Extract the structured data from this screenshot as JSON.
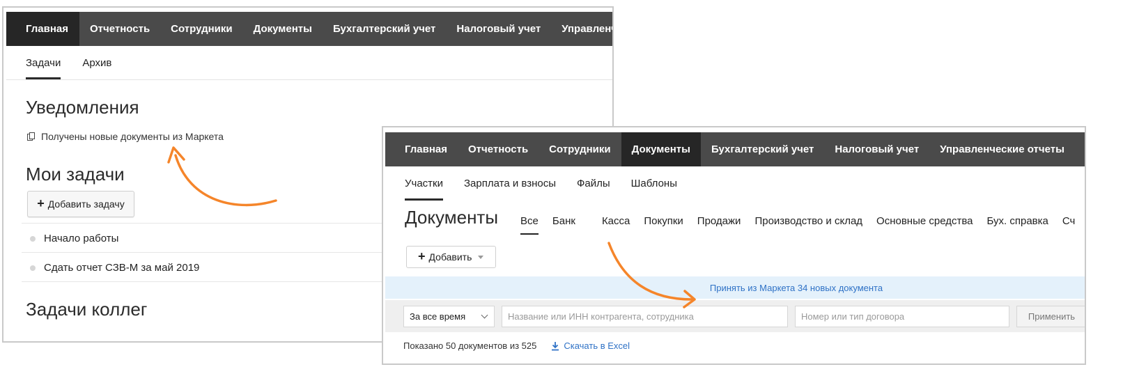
{
  "colors": {
    "nav_bg": "#4a4a4a",
    "nav_active_bg": "#262626",
    "banner_bg": "#e4f1fb",
    "link": "#2f72c6",
    "arrow": "#f5852a"
  },
  "window1": {
    "nav": [
      "Главная",
      "Отчетность",
      "Сотрудники",
      "Документы",
      "Бухгалтерский учет",
      "Налоговый учет",
      "Управленч"
    ],
    "nav_active_index": 0,
    "tabs": [
      "Задачи",
      "Архив"
    ],
    "tab_active_index": 0,
    "notifications_title": "Уведомления",
    "notification_text": "Получены новые документы из Маркета",
    "my_tasks_title": "Мои задачи",
    "add_task_label": "Добавить задачу",
    "tasks": [
      "Начало работы",
      "Сдать отчет СЗВ-М за май 2019"
    ],
    "colleagues_title": "Задачи коллег"
  },
  "window2": {
    "nav": [
      "Главная",
      "Отчетность",
      "Сотрудники",
      "Документы",
      "Бухгалтерский учет",
      "Налоговый учет",
      "Управленческие отчеты"
    ],
    "nav_active_index": 3,
    "tabs": [
      "Участки",
      "Зарплата и взносы",
      "Файлы",
      "Шаблоны"
    ],
    "tab_active_index": 0,
    "docs_title": "Документы",
    "doc_filters": [
      "Все",
      "Банк",
      "Касса",
      "Покупки",
      "Продажи",
      "Производство и склад",
      "Основные средства",
      "Бух. справка",
      "Сч"
    ],
    "doc_filter_active_index": 0,
    "add_label": "Добавить",
    "banner_link": "Принять из Маркета 34 новых документа",
    "period_value": "За все время",
    "contractor_placeholder": "Название или ИНН контрагента, сотрудника",
    "contract_placeholder": "Номер или тип договора",
    "apply_label": "Применить",
    "shown_text": "Показано 50 документов из 525",
    "excel_label": "Скачать в Excel"
  }
}
